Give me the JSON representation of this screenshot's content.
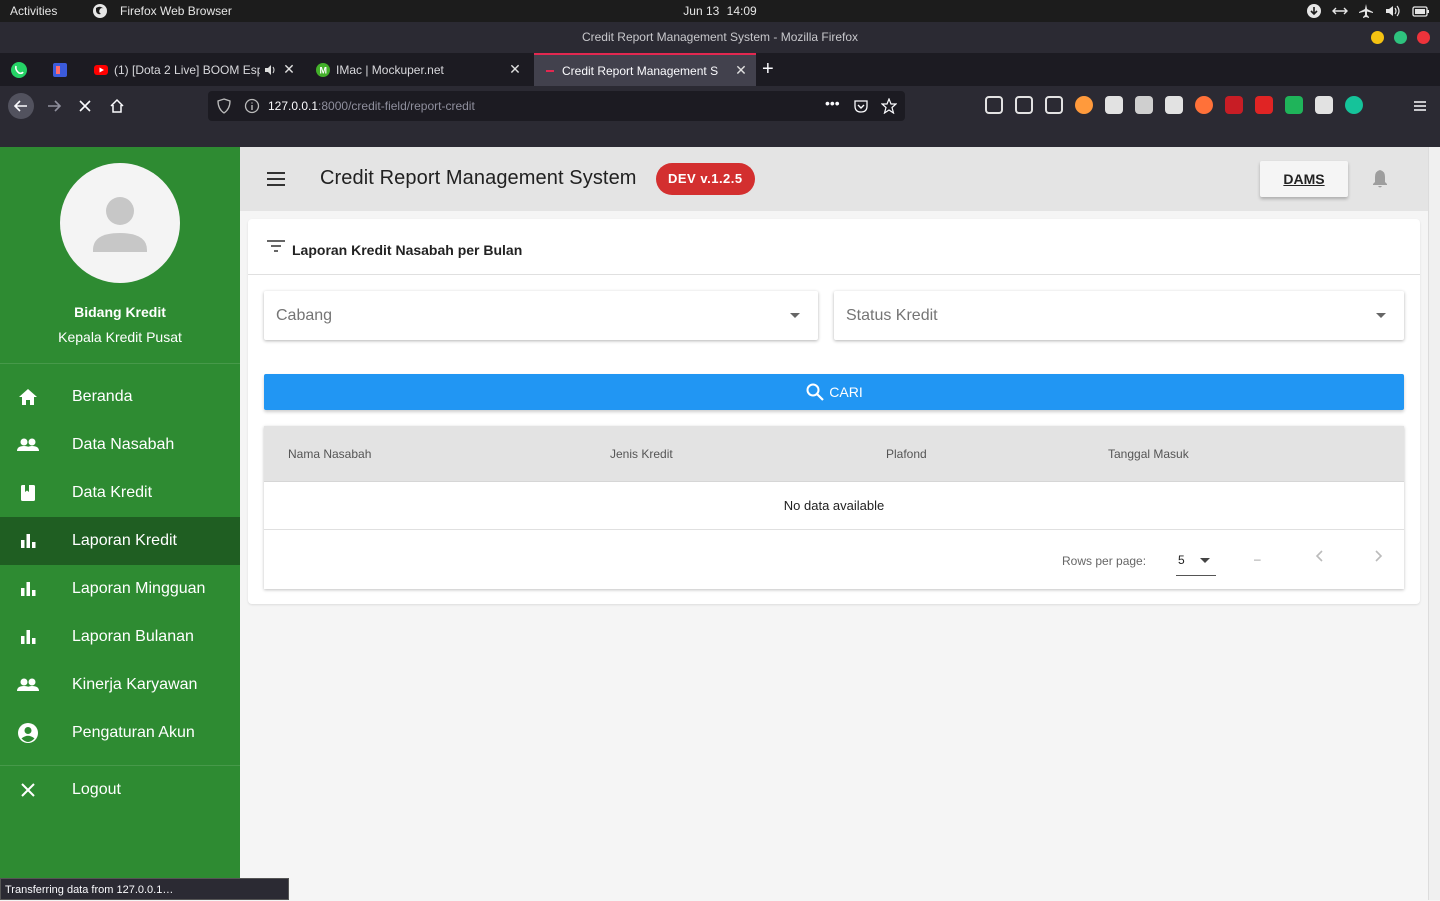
{
  "system": {
    "activities": "Activities",
    "app_name": "Firefox Web Browser",
    "date": "Jun 13",
    "time": "14:09"
  },
  "window": {
    "title": "Credit Report Management System - Mozilla Firefox"
  },
  "tabs": [
    {
      "label": "(1) [Dota 2 Live] BOOM Esp",
      "fav_color": "#ff0000"
    },
    {
      "label": "IMac | Mockuper.net",
      "fav_color": "#43b02a"
    },
    {
      "label": "Credit Report Management S",
      "fav_color": "#e22850"
    }
  ],
  "url": {
    "host": "127.0.0.1",
    "rest": ":8000/credit-field/report-credit"
  },
  "toolbar_icon_colors": [
    "#e2e2e2",
    "#e2e2e2",
    "#e2e2e2",
    "#ff9a3c",
    "#e2e2e2",
    "#cfcfcf",
    "#e2e2e2",
    "#ff7139",
    "#c81d25",
    "#e02424",
    "#1fb45a",
    "#e2e2e2",
    "#15c39a"
  ],
  "sidebar": {
    "user_name": "Bidang Kredit",
    "user_role": "Kepala Kredit Pusat",
    "items": [
      {
        "label": "Beranda",
        "icon": "home-icon"
      },
      {
        "label": "Data Nasabah",
        "icon": "people-icon"
      },
      {
        "label": "Data Kredit",
        "icon": "book-icon"
      },
      {
        "label": "Laporan Kredit",
        "icon": "bar-chart-icon"
      },
      {
        "label": "Laporan Mingguan",
        "icon": "bar-chart-icon"
      },
      {
        "label": "Laporan Bulanan",
        "icon": "bar-chart-icon"
      },
      {
        "label": "Kinerja Karyawan",
        "icon": "people-icon"
      },
      {
        "label": "Pengaturan Akun",
        "icon": "account-circle-icon"
      }
    ],
    "active_item": "Laporan Kredit",
    "logout": "Logout"
  },
  "header": {
    "title": "Credit Report Management System",
    "version": "DEV v.1.2.5",
    "dams": "DAMS"
  },
  "card": {
    "title": "Laporan Kredit Nasabah per Bulan",
    "cabang_placeholder": "Cabang",
    "status_placeholder": "Status Kredit",
    "search_label": "CARI"
  },
  "table": {
    "headers": [
      "Nama Nasabah",
      "Jenis Kredit",
      "Plafond",
      "Tanggal Masuk"
    ],
    "empty": "No data available",
    "rows_per_page_label": "Rows per page:",
    "rows_per_page_value": "5",
    "range": "–"
  },
  "status_bar": "Transferring data from 127.0.0.1…",
  "colors": {
    "sidebar_bg": "#2e8b32",
    "sidebar_active": "#1f5e22",
    "primary": "#2196f3",
    "badge": "#d32f2f"
  }
}
